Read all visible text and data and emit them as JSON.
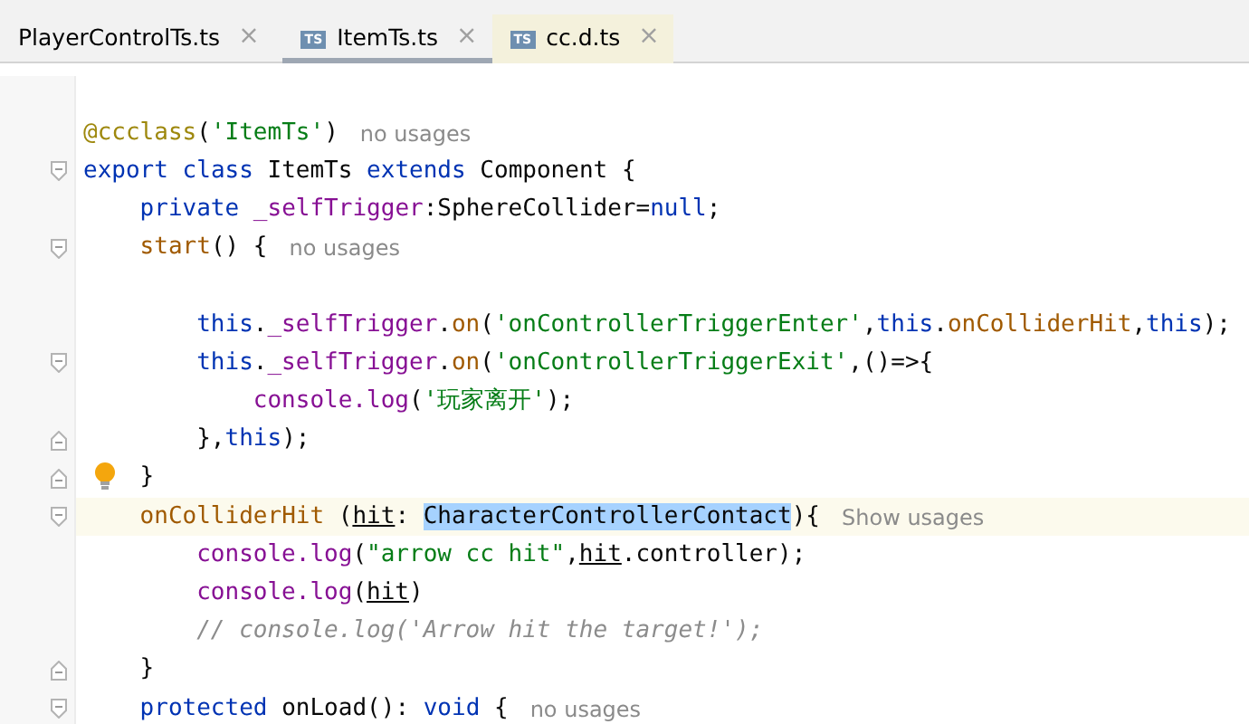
{
  "tabs": [
    {
      "label": "PlayerControlTs.ts",
      "selected": false,
      "kind": "project",
      "close": "×"
    },
    {
      "label": "ItemTs.ts",
      "icon": "TS",
      "selected": true,
      "kind": "project",
      "close": "×"
    },
    {
      "label": "cc.d.ts",
      "icon": "TS",
      "selected": false,
      "kind": "library",
      "close": "×"
    }
  ],
  "lines": [
    {
      "blank_before": true,
      "tokens": [
        {
          "t": "@ccclass",
          "color": "#9e880d"
        },
        {
          "t": "(",
          "color": "#080808"
        },
        {
          "t": "'ItemTs'",
          "color": "#067d17"
        },
        {
          "t": ")",
          "color": "#080808"
        }
      ],
      "hint": "no usages"
    },
    {
      "fold_start": true,
      "tokens": [
        {
          "t": "export class ",
          "color": "#0033b3"
        },
        {
          "t": "ItemTs ",
          "color": "#080808"
        },
        {
          "t": "extends ",
          "color": "#0033b3"
        },
        {
          "t": "Component {",
          "color": "#080808"
        }
      ],
      "children": [
        {
          "tokens": [
            {
              "t": "private ",
              "color": "#0033b3"
            },
            {
              "t": "_selfTrigger",
              "color": "#871094"
            },
            {
              "t": ":SphereCollider=",
              "color": "#080808"
            },
            {
              "t": "null",
              "color": "#0033b3"
            },
            {
              "t": ";",
              "color": "#080808"
            }
          ]
        },
        {
          "fold_start": true,
          "tokens": [
            {
              "t": "start",
              "color": "#a05a00"
            },
            {
              "t": "() {",
              "color": "#080808"
            }
          ],
          "hint": "no usages",
          "children": [
            {
              "blank_before": true,
              "tokens": [
                {
                  "t": "this",
                  "color": "#0033b3"
                },
                {
                  "t": ".",
                  "color": "#080808"
                },
                {
                  "t": "_selfTrigger",
                  "color": "#871094"
                },
                {
                  "t": ".",
                  "color": "#080808"
                },
                {
                  "t": "on",
                  "color": "#a05a00"
                },
                {
                  "t": "(",
                  "color": "#080808"
                },
                {
                  "t": "'onControllerTriggerEnter'",
                  "color": "#067d17"
                },
                {
                  "t": ",",
                  "color": "#080808"
                },
                {
                  "t": "this",
                  "color": "#0033b3"
                },
                {
                  "t": ".",
                  "color": "#080808"
                },
                {
                  "t": "onColliderHit",
                  "color": "#a05a00"
                },
                {
                  "t": ",",
                  "color": "#080808"
                },
                {
                  "t": "this",
                  "color": "#0033b3"
                },
                {
                  "t": ");",
                  "color": "#080808"
                }
              ]
            },
            {
              "fold_start": true,
              "tokens": [
                {
                  "t": "this",
                  "color": "#0033b3"
                },
                {
                  "t": ".",
                  "color": "#080808"
                },
                {
                  "t": "_selfTrigger",
                  "color": "#871094"
                },
                {
                  "t": ".",
                  "color": "#080808"
                },
                {
                  "t": "on",
                  "color": "#a05a00"
                },
                {
                  "t": "(",
                  "color": "#080808"
                },
                {
                  "t": "'onControllerTriggerExit'",
                  "color": "#067d17"
                },
                {
                  "t": ",()=>{",
                  "color": "#080808"
                }
              ],
              "children": [
                {
                  "tokens": [
                    {
                      "t": "console.log",
                      "color": "#871094"
                    },
                    {
                      "t": "(",
                      "color": "#080808"
                    },
                    {
                      "t": "'玩家离开'",
                      "color": "#067d17"
                    },
                    {
                      "t": ");",
                      "color": "#080808"
                    }
                  ]
                }
              ]
            },
            {
              "fold_end": true,
              "tokens": [
                {
                  "t": "},",
                  "color": "#080808"
                },
                {
                  "t": "this",
                  "color": "#0033b3"
                },
                {
                  "t": ");",
                  "color": "#080808"
                }
              ]
            }
          ]
        },
        {
          "fold_end": true,
          "bulb": true,
          "tokens": [
            {
              "t": "}",
              "color": "#080808"
            }
          ]
        },
        {
          "fold_start": true,
          "current": true,
          "tokens": [
            {
              "t": "onColliderHit ",
              "color": "#a05a00"
            },
            {
              "t": "(",
              "color": "#080808"
            },
            {
              "t": "hit",
              "color": "#080808",
              "underlined": true
            },
            {
              "t": ": ",
              "color": "#080808"
            },
            {
              "t": "CharacterControllerContact",
              "selected": true
            },
            {
              "t": "){",
              "color": "#080808"
            }
          ],
          "hint": "Show usages",
          "children": [
            {
              "tokens": [
                {
                  "t": "console.log",
                  "color": "#871094"
                },
                {
                  "t": "(",
                  "color": "#080808"
                },
                {
                  "t": "\"arrow cc hit\"",
                  "color": "#067d17"
                },
                {
                  "t": ",",
                  "color": "#080808"
                },
                {
                  "t": "hit",
                  "color": "#080808",
                  "underlined": true
                },
                {
                  "t": ".controller);",
                  "color": "#080808"
                }
              ]
            },
            {
              "tokens": [
                {
                  "t": "console.log",
                  "color": "#871094"
                },
                {
                  "t": "(",
                  "color": "#080808"
                },
                {
                  "t": "hit",
                  "color": "#080808",
                  "underlined": true
                },
                {
                  "t": ")",
                  "color": "#080808"
                }
              ]
            },
            {
              "tokens": [
                {
                  "t": "// console.log('Arrow hit the target!');",
                  "color": "#8c8c8c",
                  "italic": true
                }
              ]
            }
          ]
        },
        {
          "fold_end": true,
          "tokens": [
            {
              "t": "}",
              "color": "#080808"
            }
          ]
        },
        {
          "fold_start": true,
          "tokens": [
            {
              "t": "protected ",
              "color": "#0033b3"
            },
            {
              "t": "onLoad",
              "color": "#080808"
            },
            {
              "t": "(): ",
              "color": "#080808"
            },
            {
              "t": "void ",
              "color": "#0033b3"
            },
            {
              "t": "{",
              "color": "#080808"
            }
          ],
          "hint": "no usages"
        }
      ]
    }
  ]
}
